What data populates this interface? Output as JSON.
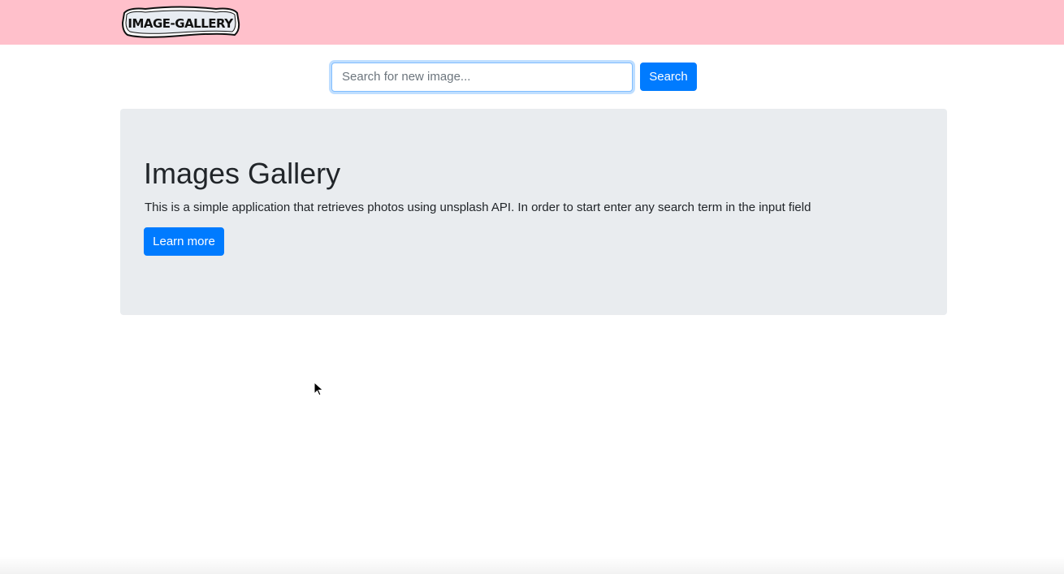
{
  "navbar": {
    "logo_text": "IMAGE-GALLERY",
    "background_color": "#ffc0cb"
  },
  "search": {
    "placeholder": "Search for new image...",
    "value": "",
    "button_label": "Search"
  },
  "jumbotron": {
    "title": "Images Gallery",
    "lead": "This is a simple application that retrieves photos using unsplash API. In order to start enter any search term in the input field",
    "button_label": "Learn more",
    "background_color": "#e9ecef"
  },
  "colors": {
    "primary": "#007bff",
    "text": "#212529"
  },
  "icons": {
    "cursor": "pointer-cursor-icon"
  }
}
